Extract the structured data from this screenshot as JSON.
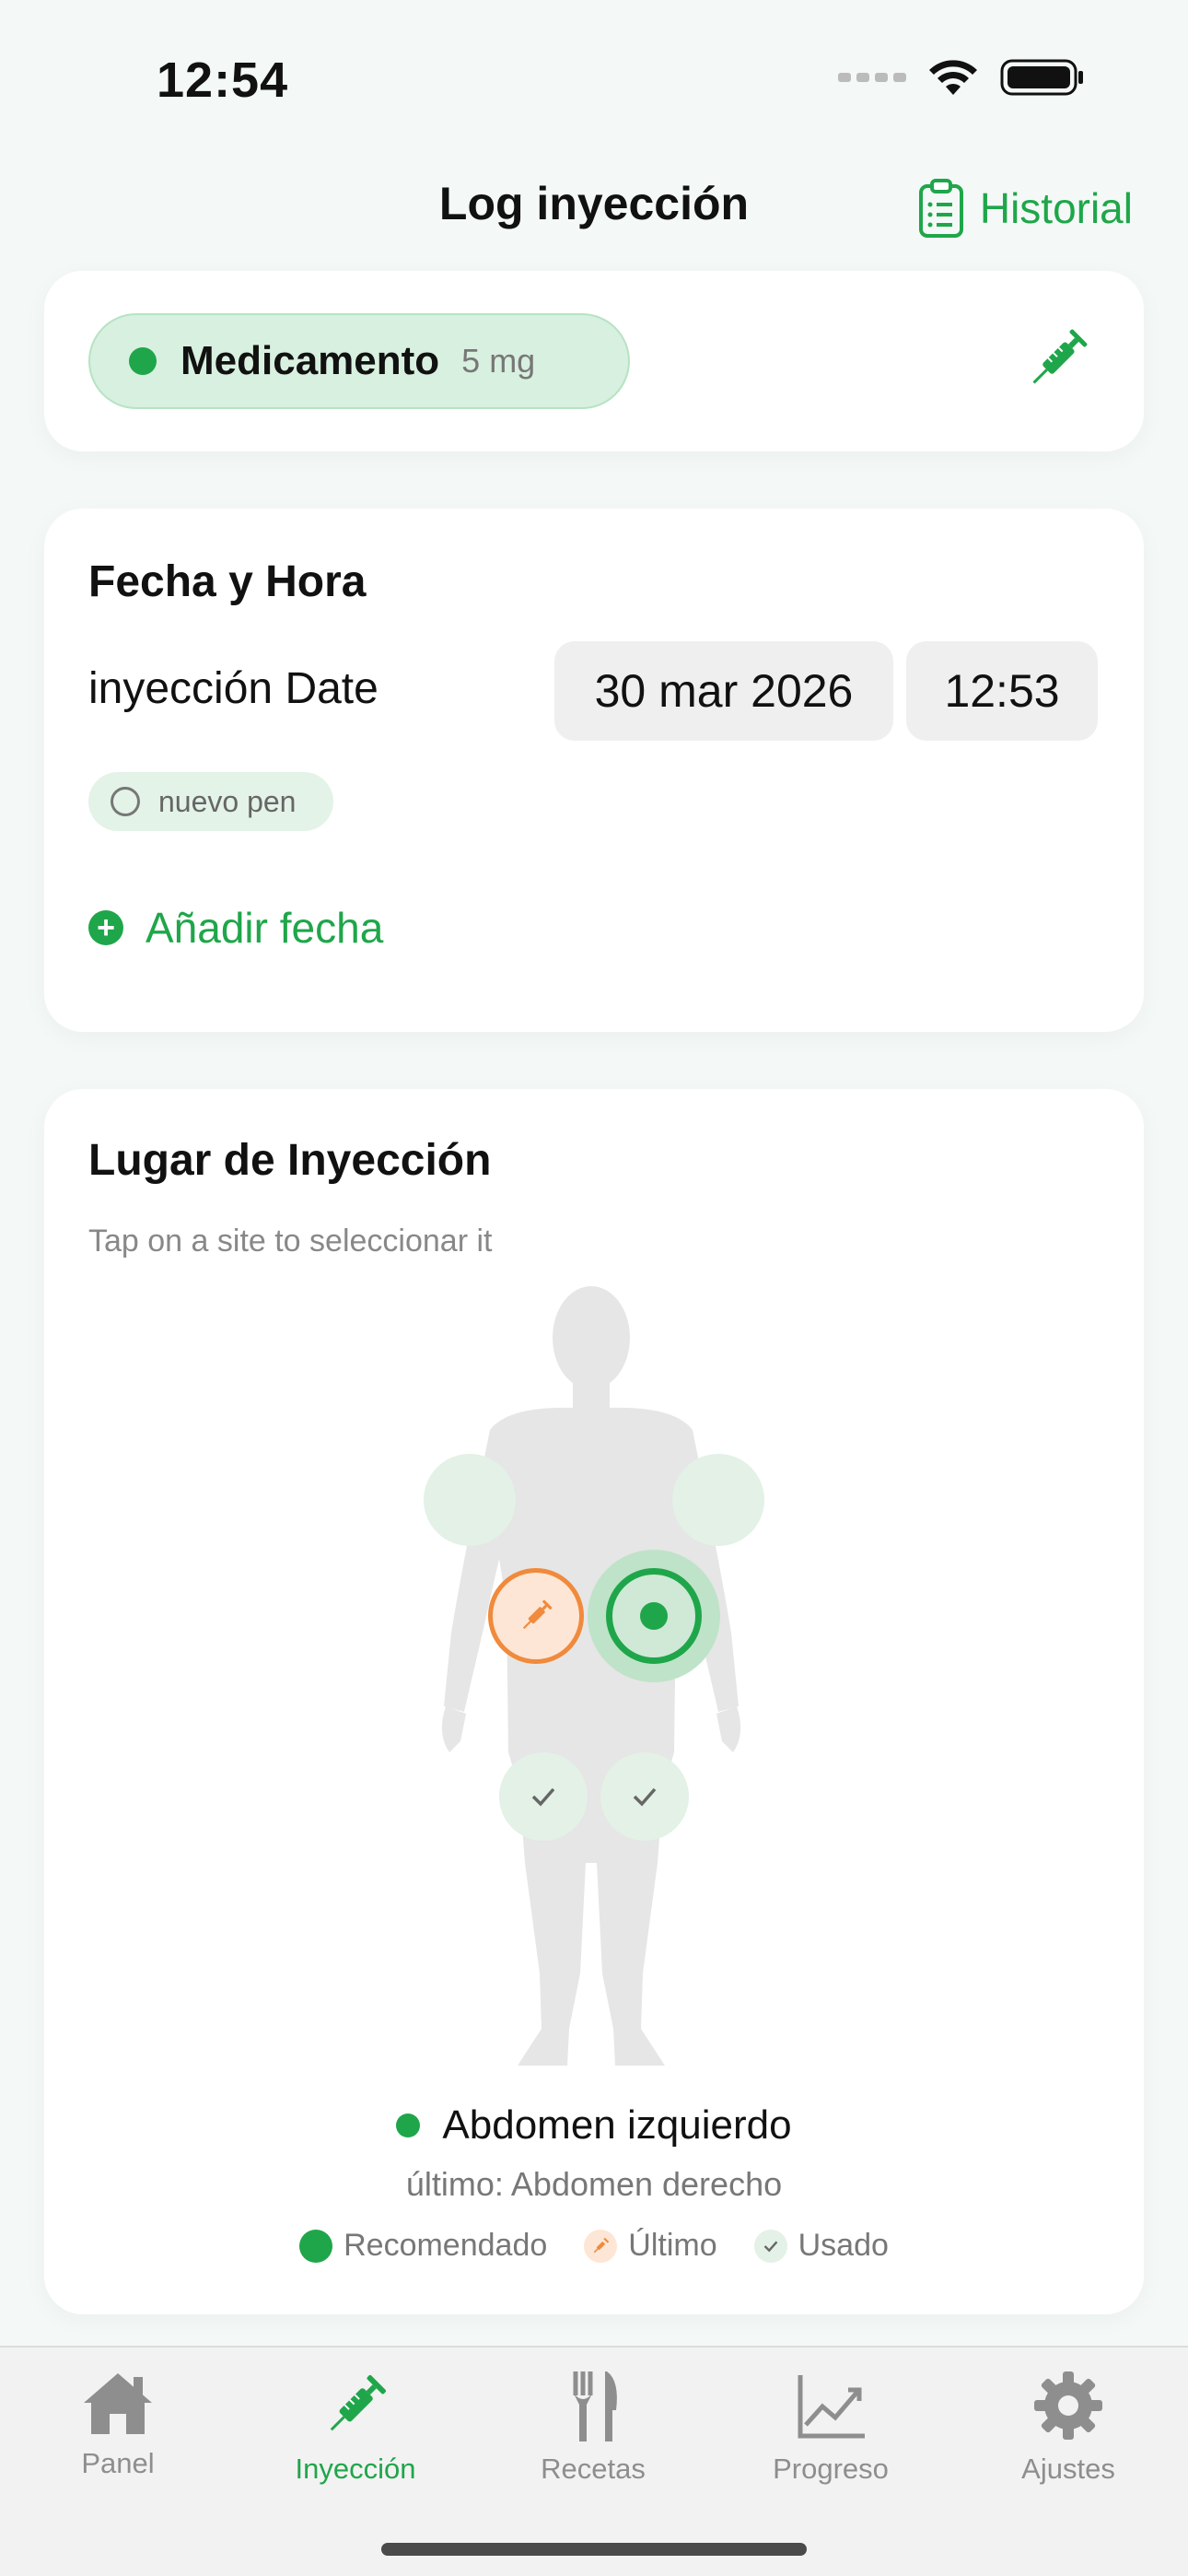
{
  "status_bar": {
    "time": "12:54"
  },
  "nav": {
    "title": "Log inyección",
    "history_label": "Historial"
  },
  "medication": {
    "name": "Medicamento",
    "dose": "5 mg",
    "status_color": "#1fa64a"
  },
  "date_card": {
    "title": "Fecha y Hora",
    "date_label": "inyección Date",
    "date_value": "30 mar 2026",
    "time_value": "12:53",
    "pen_toggle_label": "nuevo pen",
    "add_date_label": "Añadir fecha"
  },
  "site_card": {
    "title": "Lugar de Inyección",
    "subtitle": "Tap on a site to seleccionar it",
    "selected_site": "Abdomen izquierdo",
    "last_site_text": "último: Abdomen derecho",
    "legend": {
      "recommended": "Recomendado",
      "last": "Último",
      "used": "Usado"
    },
    "sites": [
      {
        "id": "arm-right",
        "state": "available"
      },
      {
        "id": "arm-left",
        "state": "available"
      },
      {
        "id": "abdomen-right",
        "state": "last"
      },
      {
        "id": "abdomen-left",
        "state": "selected"
      },
      {
        "id": "thigh-right",
        "state": "used"
      },
      {
        "id": "thigh-left",
        "state": "used"
      }
    ]
  },
  "tabs": [
    {
      "label": "Panel",
      "icon": "house-icon",
      "active": false
    },
    {
      "label": "Inyección",
      "icon": "syringe-icon",
      "active": true
    },
    {
      "label": "Recetas",
      "icon": "fork-knife-icon",
      "active": false
    },
    {
      "label": "Progreso",
      "icon": "chart-icon",
      "active": false
    },
    {
      "label": "Ajustes",
      "icon": "gear-icon",
      "active": false
    }
  ],
  "colors": {
    "accent": "#1fa64a",
    "last": "#f08a3c",
    "background": "#f4f9f7"
  }
}
